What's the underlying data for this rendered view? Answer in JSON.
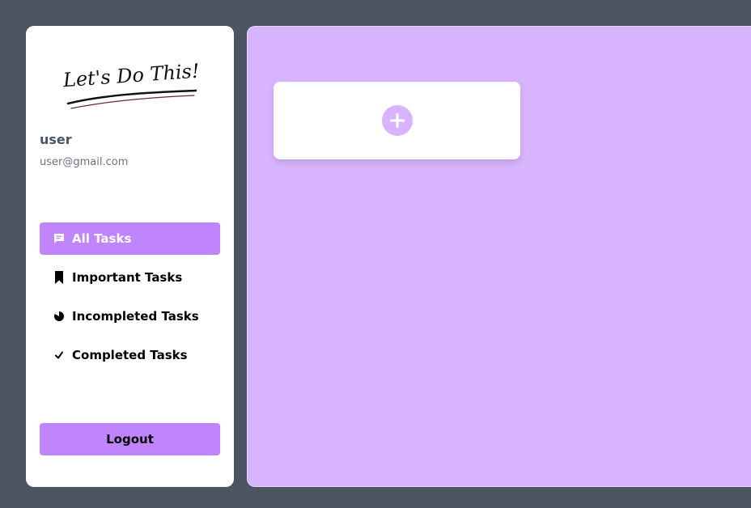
{
  "logo": {
    "text": "Let's Do This!"
  },
  "user": {
    "name": "user",
    "email": "user@gmail.com"
  },
  "nav": {
    "items": [
      {
        "label": "All Tasks",
        "icon": "list-icon",
        "active": true
      },
      {
        "label": "Important Tasks",
        "icon": "bookmark-icon",
        "active": false
      },
      {
        "label": "Incompleted Tasks",
        "icon": "pie-icon",
        "active": false
      },
      {
        "label": "Completed Tasks",
        "icon": "check-icon",
        "active": false
      }
    ]
  },
  "logout": {
    "label": "Logout"
  },
  "add_card": {
    "icon": "plus-icon"
  },
  "colors": {
    "accent": "#c084fc",
    "panel": "#d8b4fe",
    "background": "#4b5563"
  }
}
